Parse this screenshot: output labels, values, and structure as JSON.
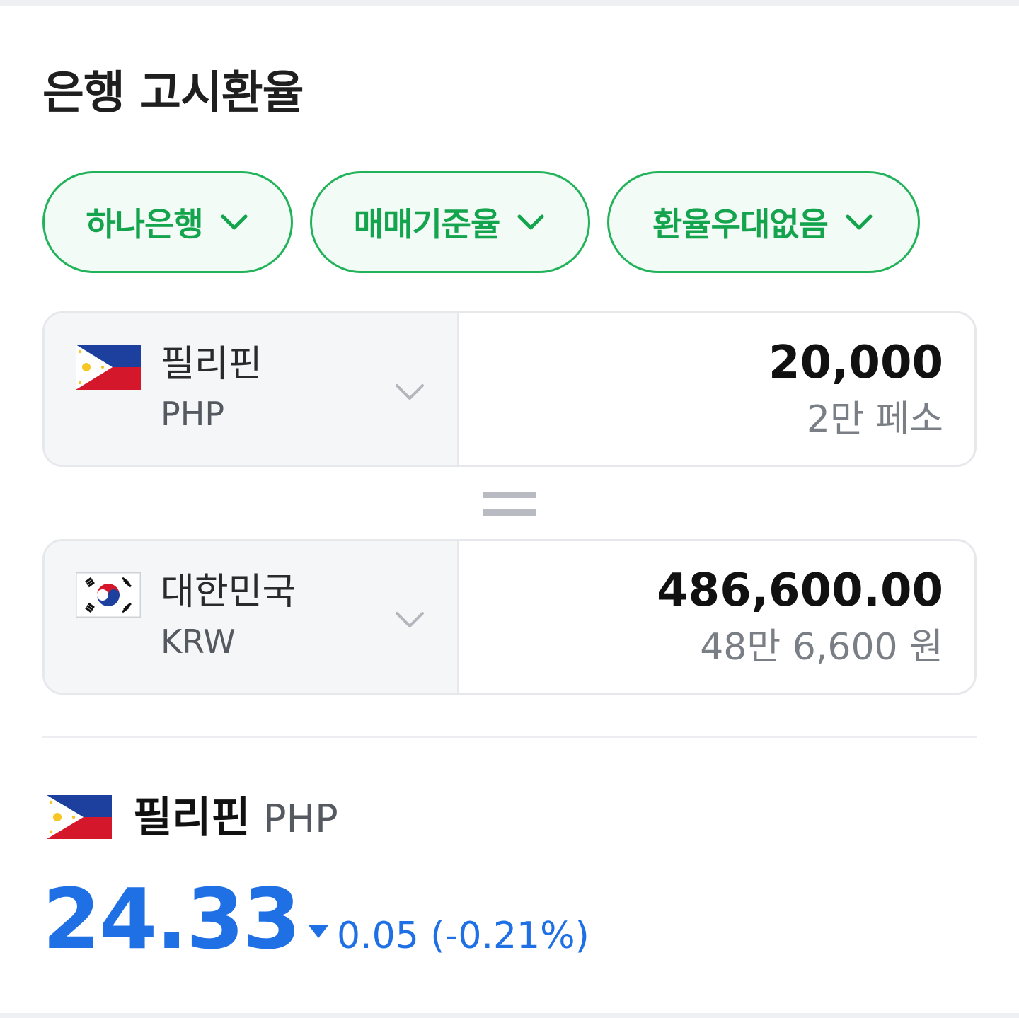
{
  "title": "은행 고시환율",
  "filters": {
    "bank": "하나은행",
    "rate_type": "매매기준율",
    "preference": "환율우대없음"
  },
  "from": {
    "name": "필리핀",
    "code": "PHP",
    "amount": "20,000",
    "amount_words": "2만 페소",
    "flag_icon": "philippines-flag-icon"
  },
  "to": {
    "name": "대한민국",
    "code": "KRW",
    "amount": "486,600.00",
    "amount_words": "48만 6,600 원",
    "flag_icon": "korea-flag-icon"
  },
  "rate": {
    "name": "필리핀",
    "code": "PHP",
    "value": "24.33",
    "change": "0.05 (-0.21%)",
    "direction": "down"
  },
  "colors": {
    "accent_green": "#22b35a",
    "rate_blue": "#1f6fe5"
  }
}
